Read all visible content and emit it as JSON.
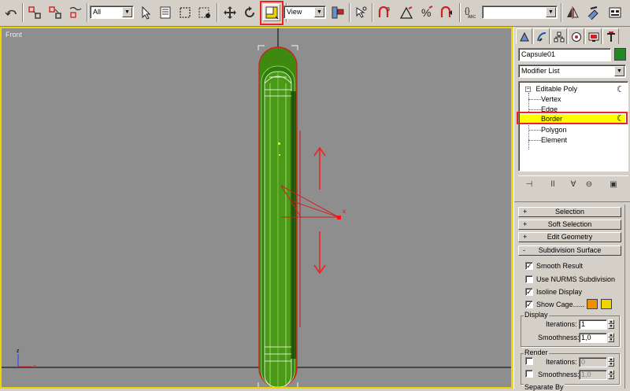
{
  "toolbar": {
    "selection_filter": "All",
    "coord_system": "View",
    "named_selection": ""
  },
  "viewport": {
    "label": "Front",
    "axis_z": "z",
    "axis_x": "x",
    "gizmo_x": "x",
    "colors": {
      "border": "#f0d400",
      "background": "#8e8e8e",
      "object": "#3e8a10",
      "arrow": "#ee2222"
    }
  },
  "panel": {
    "object_name": "Capsule01",
    "object_color": "#1f8a1f",
    "modifier_list": "Modifier List",
    "stack": [
      {
        "label": "Editable Poly",
        "level": 0
      },
      {
        "label": "Vertex",
        "level": 1
      },
      {
        "label": "Edge",
        "level": 1
      },
      {
        "label": "Border",
        "level": 1,
        "selected": true
      },
      {
        "label": "Polygon",
        "level": 1
      },
      {
        "label": "Element",
        "level": 1
      }
    ],
    "rollouts": [
      {
        "sign": "+",
        "label": "Selection"
      },
      {
        "sign": "+",
        "label": "Soft Selection"
      },
      {
        "sign": "+",
        "label": "Edit Geometry"
      },
      {
        "sign": "-",
        "label": "Subdivision Surface"
      }
    ],
    "subdivision": {
      "smooth_result": {
        "label": "Smooth Result",
        "checked": true
      },
      "use_nurms": {
        "label": "Use NURMS Subdivision",
        "checked": false
      },
      "isoline": {
        "label": "Isoline Display",
        "checked": true
      },
      "show_cage": {
        "label": "Show Cage......",
        "checked": true,
        "colors": [
          "#f09000",
          "#f0d400"
        ]
      },
      "display": {
        "title": "Display",
        "iterations_label": "Iterations:",
        "iterations": "1",
        "smoothness_label": "Smoothness:",
        "smoothness": "1,0"
      },
      "render": {
        "title": "Render",
        "iterations_label": "Iterations:",
        "iterations": "0",
        "smoothness_label": "Smoothness:",
        "smoothness": "1,0"
      },
      "separate_by": "Separate By"
    }
  }
}
